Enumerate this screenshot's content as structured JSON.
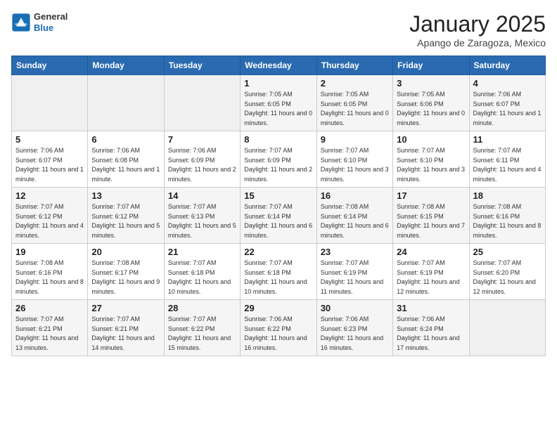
{
  "logo": {
    "general": "General",
    "blue": "Blue"
  },
  "header": {
    "month": "January 2025",
    "location": "Apango de Zaragoza, Mexico"
  },
  "days_header": [
    "Sunday",
    "Monday",
    "Tuesday",
    "Wednesday",
    "Thursday",
    "Friday",
    "Saturday"
  ],
  "weeks": [
    [
      {
        "day": "",
        "sunrise": "",
        "sunset": "",
        "daylight": ""
      },
      {
        "day": "",
        "sunrise": "",
        "sunset": "",
        "daylight": ""
      },
      {
        "day": "",
        "sunrise": "",
        "sunset": "",
        "daylight": ""
      },
      {
        "day": "1",
        "sunrise": "Sunrise: 7:05 AM",
        "sunset": "Sunset: 6:05 PM",
        "daylight": "Daylight: 11 hours and 0 minutes."
      },
      {
        "day": "2",
        "sunrise": "Sunrise: 7:05 AM",
        "sunset": "Sunset: 6:05 PM",
        "daylight": "Daylight: 11 hours and 0 minutes."
      },
      {
        "day": "3",
        "sunrise": "Sunrise: 7:05 AM",
        "sunset": "Sunset: 6:06 PM",
        "daylight": "Daylight: 11 hours and 0 minutes."
      },
      {
        "day": "4",
        "sunrise": "Sunrise: 7:06 AM",
        "sunset": "Sunset: 6:07 PM",
        "daylight": "Daylight: 11 hours and 1 minute."
      }
    ],
    [
      {
        "day": "5",
        "sunrise": "Sunrise: 7:06 AM",
        "sunset": "Sunset: 6:07 PM",
        "daylight": "Daylight: 11 hours and 1 minute."
      },
      {
        "day": "6",
        "sunrise": "Sunrise: 7:06 AM",
        "sunset": "Sunset: 6:08 PM",
        "daylight": "Daylight: 11 hours and 1 minute."
      },
      {
        "day": "7",
        "sunrise": "Sunrise: 7:06 AM",
        "sunset": "Sunset: 6:09 PM",
        "daylight": "Daylight: 11 hours and 2 minutes."
      },
      {
        "day": "8",
        "sunrise": "Sunrise: 7:07 AM",
        "sunset": "Sunset: 6:09 PM",
        "daylight": "Daylight: 11 hours and 2 minutes."
      },
      {
        "day": "9",
        "sunrise": "Sunrise: 7:07 AM",
        "sunset": "Sunset: 6:10 PM",
        "daylight": "Daylight: 11 hours and 3 minutes."
      },
      {
        "day": "10",
        "sunrise": "Sunrise: 7:07 AM",
        "sunset": "Sunset: 6:10 PM",
        "daylight": "Daylight: 11 hours and 3 minutes."
      },
      {
        "day": "11",
        "sunrise": "Sunrise: 7:07 AM",
        "sunset": "Sunset: 6:11 PM",
        "daylight": "Daylight: 11 hours and 4 minutes."
      }
    ],
    [
      {
        "day": "12",
        "sunrise": "Sunrise: 7:07 AM",
        "sunset": "Sunset: 6:12 PM",
        "daylight": "Daylight: 11 hours and 4 minutes."
      },
      {
        "day": "13",
        "sunrise": "Sunrise: 7:07 AM",
        "sunset": "Sunset: 6:12 PM",
        "daylight": "Daylight: 11 hours and 5 minutes."
      },
      {
        "day": "14",
        "sunrise": "Sunrise: 7:07 AM",
        "sunset": "Sunset: 6:13 PM",
        "daylight": "Daylight: 11 hours and 5 minutes."
      },
      {
        "day": "15",
        "sunrise": "Sunrise: 7:07 AM",
        "sunset": "Sunset: 6:14 PM",
        "daylight": "Daylight: 11 hours and 6 minutes."
      },
      {
        "day": "16",
        "sunrise": "Sunrise: 7:08 AM",
        "sunset": "Sunset: 6:14 PM",
        "daylight": "Daylight: 11 hours and 6 minutes."
      },
      {
        "day": "17",
        "sunrise": "Sunrise: 7:08 AM",
        "sunset": "Sunset: 6:15 PM",
        "daylight": "Daylight: 11 hours and 7 minutes."
      },
      {
        "day": "18",
        "sunrise": "Sunrise: 7:08 AM",
        "sunset": "Sunset: 6:16 PM",
        "daylight": "Daylight: 11 hours and 8 minutes."
      }
    ],
    [
      {
        "day": "19",
        "sunrise": "Sunrise: 7:08 AM",
        "sunset": "Sunset: 6:16 PM",
        "daylight": "Daylight: 11 hours and 8 minutes."
      },
      {
        "day": "20",
        "sunrise": "Sunrise: 7:08 AM",
        "sunset": "Sunset: 6:17 PM",
        "daylight": "Daylight: 11 hours and 9 minutes."
      },
      {
        "day": "21",
        "sunrise": "Sunrise: 7:07 AM",
        "sunset": "Sunset: 6:18 PM",
        "daylight": "Daylight: 11 hours and 10 minutes."
      },
      {
        "day": "22",
        "sunrise": "Sunrise: 7:07 AM",
        "sunset": "Sunset: 6:18 PM",
        "daylight": "Daylight: 11 hours and 10 minutes."
      },
      {
        "day": "23",
        "sunrise": "Sunrise: 7:07 AM",
        "sunset": "Sunset: 6:19 PM",
        "daylight": "Daylight: 11 hours and 11 minutes."
      },
      {
        "day": "24",
        "sunrise": "Sunrise: 7:07 AM",
        "sunset": "Sunset: 6:19 PM",
        "daylight": "Daylight: 11 hours and 12 minutes."
      },
      {
        "day": "25",
        "sunrise": "Sunrise: 7:07 AM",
        "sunset": "Sunset: 6:20 PM",
        "daylight": "Daylight: 11 hours and 12 minutes."
      }
    ],
    [
      {
        "day": "26",
        "sunrise": "Sunrise: 7:07 AM",
        "sunset": "Sunset: 6:21 PM",
        "daylight": "Daylight: 11 hours and 13 minutes."
      },
      {
        "day": "27",
        "sunrise": "Sunrise: 7:07 AM",
        "sunset": "Sunset: 6:21 PM",
        "daylight": "Daylight: 11 hours and 14 minutes."
      },
      {
        "day": "28",
        "sunrise": "Sunrise: 7:07 AM",
        "sunset": "Sunset: 6:22 PM",
        "daylight": "Daylight: 11 hours and 15 minutes."
      },
      {
        "day": "29",
        "sunrise": "Sunrise: 7:06 AM",
        "sunset": "Sunset: 6:22 PM",
        "daylight": "Daylight: 11 hours and 16 minutes."
      },
      {
        "day": "30",
        "sunrise": "Sunrise: 7:06 AM",
        "sunset": "Sunset: 6:23 PM",
        "daylight": "Daylight: 11 hours and 16 minutes."
      },
      {
        "day": "31",
        "sunrise": "Sunrise: 7:06 AM",
        "sunset": "Sunset: 6:24 PM",
        "daylight": "Daylight: 11 hours and 17 minutes."
      },
      {
        "day": "",
        "sunrise": "",
        "sunset": "",
        "daylight": ""
      }
    ]
  ]
}
